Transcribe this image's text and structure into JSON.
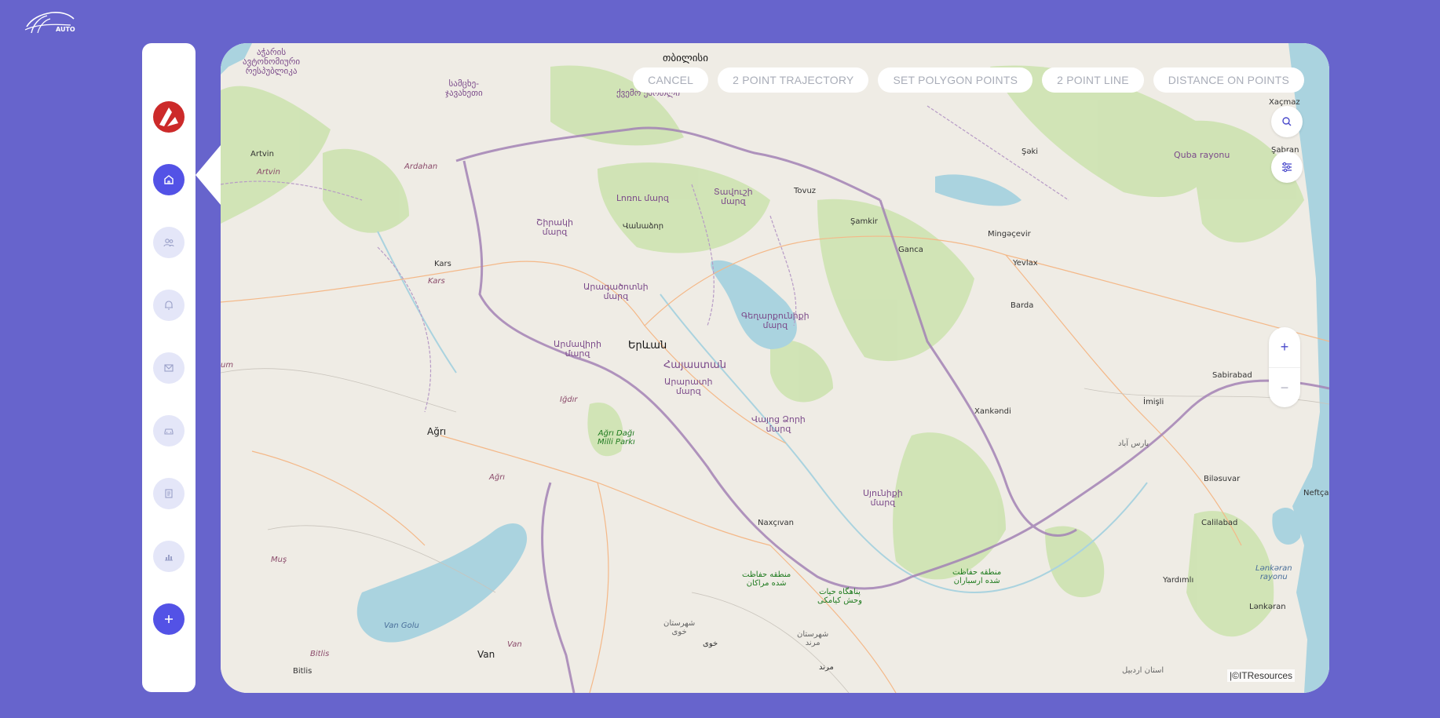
{
  "logo": {
    "text": "AUTO"
  },
  "sidebar": {
    "items": [
      {
        "name": "home",
        "icon": "home-icon",
        "active": true
      },
      {
        "name": "users",
        "icon": "users-icon",
        "active": false
      },
      {
        "name": "notifications",
        "icon": "bell-icon",
        "active": false
      },
      {
        "name": "messages",
        "icon": "mail-icon",
        "active": false
      },
      {
        "name": "vehicles",
        "icon": "car-icon",
        "active": false
      },
      {
        "name": "documents",
        "icon": "document-icon",
        "active": false
      },
      {
        "name": "reports",
        "icon": "bar-chart-icon",
        "active": false
      },
      {
        "name": "add",
        "icon": "plus-icon",
        "active": true
      }
    ]
  },
  "toolbar": {
    "cancel": "CANCEL",
    "trajectory": "2 POINT TRAJECTORY",
    "polygon": "SET POLYGON POINTS",
    "line": "2 POINT LINE",
    "distance": "DISTANCE ON POINTS"
  },
  "map": {
    "zoom_in": "+",
    "zoom_out": "−",
    "attribution": "|©ITResources",
    "places": {
      "tbilisi": "თბილისი",
      "adjara": "აჭარის\nავტონომიური\nრესპუბლიკა",
      "samtskhe": "სამცხე-\nჯავახეთი",
      "kvemo": "ქვემო ქართლი",
      "artvin1": "Artvin",
      "artvin2": "Artvin",
      "ardahan": "Ardahan",
      "lori": "Լոռու մարզ",
      "tavush": "Տավուշի\nմարզ",
      "tovuz": "Tovuz",
      "shirak": "Շիրակի\nմարզ",
      "vanadzor": "Վանաձոր",
      "samkir": "Şamkir",
      "ganca": "Ganca",
      "mingacevir": "Mingəçevir",
      "yevlax": "Yevlax",
      "kars1": "Kars",
      "kars2": "Kars",
      "aragatsotn": "Արագածոտնի\nմարզ",
      "gegharkunik": "Գեղարքունիքի\nմարզ",
      "barda": "Barda",
      "armavir": "Արմավիրի\nմարզ",
      "yerevan": "Երևան",
      "hayastan": "Հայաստան",
      "ararat": "Արարատի\nմարզ",
      "igdir": "Iğdır",
      "sabirabad": "Sabirabad",
      "imisli": "İmişli",
      "xankandi": "Xankəndi",
      "agri1": "Ağrı",
      "agri_park": "Ağrı Dağı\nMilli Parkı",
      "vayots": "Վայոց Ձորի\nմարզ",
      "pars": "پارس آباد",
      "agri2": "Ağrı",
      "syunik": "Սյունիքի\nմարզ",
      "bilasuvar": "Biləsuvar",
      "nakhchivan": "Naxçıvan",
      "calilabad": "Calilabad",
      "mantaqa1": "منطقه حفاظت\nشده مراکان",
      "mantaqa2": "منطقه حفاظت\nشده ارسباران",
      "panahgah": "پناهگاه حیات\nوحش کیامکی",
      "yardimli": "Yardımlı",
      "lankaran_r": "Lənkəran\nrayonu",
      "lankaran": "Lənkəran",
      "mus": "Muş",
      "vangolu": "Van Golu",
      "van1": "Van",
      "van2": "Van",
      "bitlis1": "Bitlis",
      "bitlis2": "Bitlis",
      "khoy": "شهرستان\nخوی",
      "khoy2": "خوی",
      "marand": "شهرستان\nمرند",
      "marand2": "مرند",
      "ardabil": "استان اردبیل",
      "qax": "Şəki",
      "xacmaz": "Xaçmaz",
      "quba": "Quba rayonu",
      "siyazan": "Şabran",
      "neftcala": "Neftça",
      "um": "um"
    }
  }
}
